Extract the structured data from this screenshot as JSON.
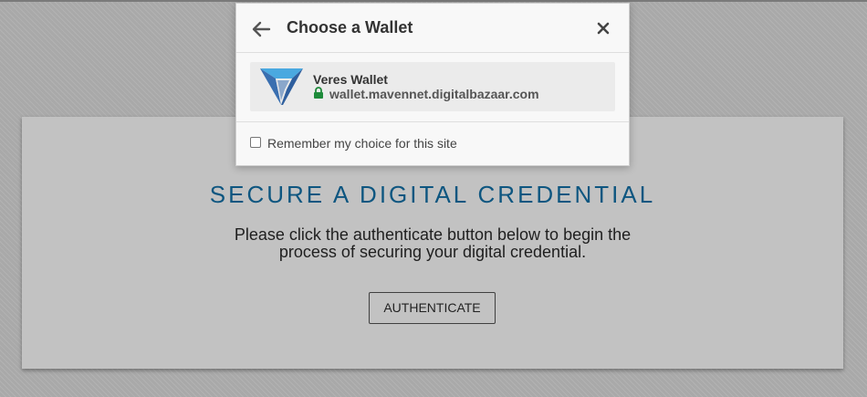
{
  "wallet_dialog": {
    "title": "Choose a Wallet",
    "back_icon": "arrow-left-icon",
    "close_icon": "close-icon",
    "wallets": [
      {
        "name": "Veres Wallet",
        "url": "wallet.mavennet.digitalbazaar.com",
        "logo_icon": "veres-logo",
        "secure_icon": "lock-icon"
      }
    ],
    "remember_label": "Remember my choice for this site",
    "remember_checked": false
  },
  "page": {
    "title": "SECURE A DIGITAL CREDENTIAL",
    "description_line1": "Please click the authenticate button below to begin the",
    "description_line2": "process of securing your digital credential.",
    "authenticate_label": "AUTHENTICATE"
  },
  "colors": {
    "title": "#0e5680",
    "lock": "#1e8a3a",
    "logo_primary": "#3a6fb0",
    "logo_secondary": "#4aa9e0"
  }
}
